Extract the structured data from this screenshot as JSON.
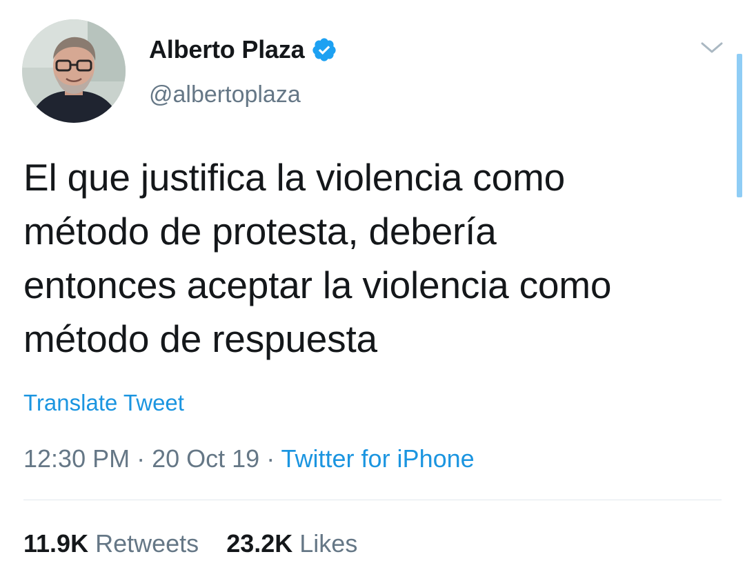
{
  "author": {
    "display_name": "Alberto Plaza",
    "handle": "@albertoplaza",
    "verified": true
  },
  "tweet": {
    "text_lines": [
      "El que justifica la violencia como",
      "método de protesta, debería",
      "entonces aceptar la violencia como",
      "método de respuesta"
    ],
    "translate_label": "Translate Tweet",
    "time": "12:30 PM",
    "separator": " · ",
    "date": "20 Oct 19",
    "source": "Twitter for iPhone"
  },
  "stats": {
    "retweets_count": "11.9K",
    "retweets_label": "Retweets",
    "likes_count": "23.2K",
    "likes_label": "Likes"
  },
  "icons": {
    "verified": "verified-badge-icon",
    "caret": "chevron-down-icon"
  },
  "colors": {
    "link": "#1b95e0",
    "secondary_text": "#657786",
    "primary_text": "#14171a",
    "verified": "#1da1f2",
    "divider": "#e1e8ed",
    "scrollbar": "#8fcdf5"
  }
}
